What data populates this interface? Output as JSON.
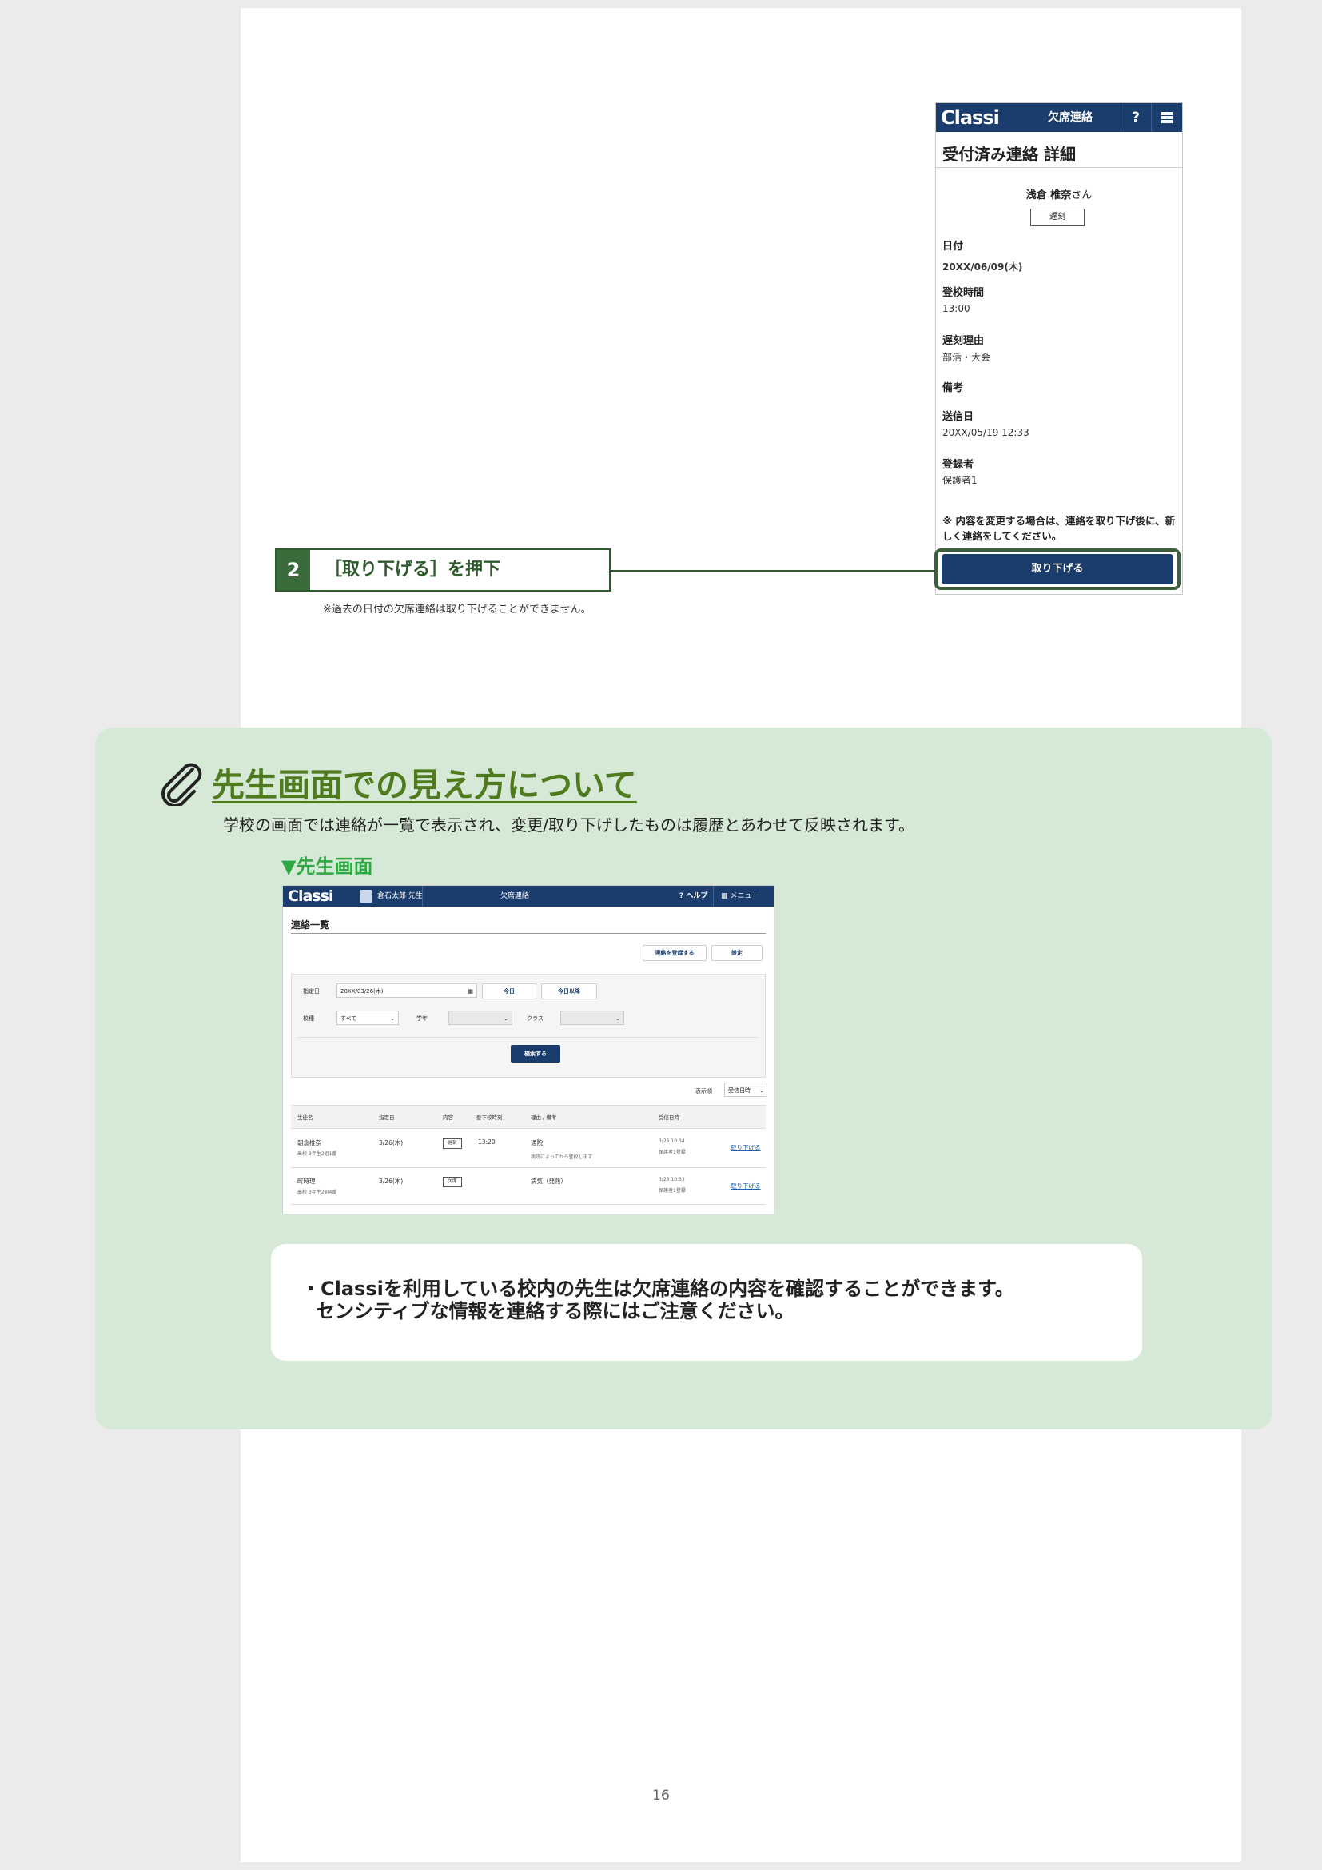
{
  "phone": {
    "logo": "Classi",
    "title": "欠席連絡",
    "help": "?",
    "heading": "受付済み連絡 詳細",
    "student_name": "浅倉 椎奈",
    "student_suffix": "さん",
    "badge": "遅刻",
    "fields": [
      {
        "label": "日付",
        "value": "20XX/06/09(木)"
      },
      {
        "label": "登校時間",
        "value": "13:00"
      },
      {
        "label": "遅刻理由",
        "value": "部活・大会"
      },
      {
        "label": "備考",
        "value": ""
      },
      {
        "label": "送信日",
        "value": "20XX/05/19 12:33"
      },
      {
        "label": "登録者",
        "value": "保護者1"
      }
    ],
    "note": "※ 内容を変更する場合は、連絡を取り下げ後に、新しく連絡をしてください。",
    "withdraw_button": "取り下げる"
  },
  "step": {
    "number": "2",
    "text": "［取り下げる］を押下",
    "note": "※過去の日付の欠席連絡は取り下げることができません。"
  },
  "teacher_section": {
    "title": "先生画面での見え方について",
    "description": "学校の画面では連絡が一覧で表示され、変更/取り下げしたものは履歴とあわせて反映されます。",
    "subheading": "▼先生画面",
    "screen": {
      "logo": "Classi",
      "teacher": "倉石太郎 先生",
      "title": "欠席連絡",
      "help": "? ヘルプ",
      "menu": "メニュー",
      "heading": "連絡一覧",
      "register_button": "連絡を登録する",
      "settings_button": "設定",
      "date_label": "指定日",
      "date_value": "20XX/03/26(木)",
      "today_button": "今日",
      "after_today_button": "今日以降",
      "school_label": "校種",
      "school_value": "すべて",
      "grade_label": "学年",
      "class_label": "クラス",
      "search_button": "検索する",
      "sort_label": "表示順",
      "sort_value": "受信日時",
      "columns": [
        "生徒名",
        "指定日",
        "内容",
        "登下校時刻",
        "理由 / 備考",
        "受信日時"
      ],
      "rows": [
        {
          "name": "朝倉椎奈",
          "class": "高校 3年生2組1番",
          "date": "3/26(木)",
          "type": "遅刻",
          "time": "13:20",
          "reason": "通院",
          "remark": "病院によってから登校します",
          "received": "3/26 10:34",
          "by": "保護者1登録",
          "action": "取り下げる"
        },
        {
          "name": "町時理",
          "class": "高校 3年生2組4番",
          "date": "3/26(木)",
          "type": "欠席",
          "time": "",
          "reason": "病気（発熱）",
          "remark": "",
          "received": "3/26 10:33",
          "by": "保護者1登録",
          "action": "取り下げる"
        }
      ]
    },
    "note_lines": [
      "・Classiを利用している校内の先生は欠席連絡の内容を確認することができます。",
      "センシティブな情報を連絡する際にはご注意ください。"
    ]
  },
  "page_number": "16"
}
